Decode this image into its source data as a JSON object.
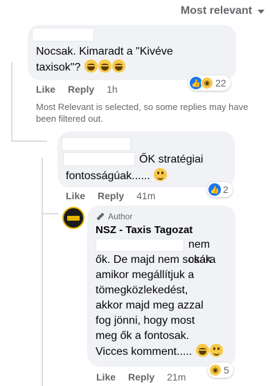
{
  "sort": {
    "label": "Most relevant",
    "icon": "caret-down-icon"
  },
  "comments": [
    {
      "text_line1": "Nocsak. Kimaradt a \"Kivéve",
      "text_line2": "taxisok\"?",
      "actions": {
        "like": "Like",
        "reply": "Reply",
        "time": "1h"
      },
      "reactions": {
        "count": "22",
        "icons": [
          "like-icon",
          "haha-icon"
        ]
      }
    },
    {
      "text_line1": "ŐK stratégiai",
      "text_line2": "fontosságúak......",
      "actions": {
        "like": "Like",
        "reply": "Reply",
        "time": "41m"
      },
      "reactions": {
        "count": "2",
        "icons": [
          "like-icon"
        ]
      }
    },
    {
      "author_badge": "Author",
      "author_name": "NSZ - Taxis Tagozat",
      "lines": [
        "nem csak",
        "ők. De majd nem sokára",
        "amikor megállítjuk a",
        "tömegközlekedést,",
        "akkor majd meg azzal",
        "fog jönni, hogy most",
        "meg ők a fontosak.",
        "Vicces komment....."
      ],
      "actions": {
        "like": "Like",
        "reply": "Reply",
        "time": "21m"
      },
      "reactions": {
        "count": "5",
        "icons": [
          "haha-icon"
        ]
      }
    }
  ],
  "notice": "Most Relevant is selected, so some replies may have been filtered out."
}
